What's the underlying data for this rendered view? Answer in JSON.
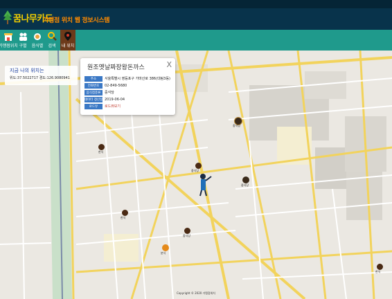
{
  "header": {
    "brand": "꿈나무카드",
    "tagline": "가맹점 위치 웹 정보시스템",
    "colors": {
      "bar": "#08334b",
      "brand": "#f5d000",
      "tagline": "#ff8a00"
    }
  },
  "nav": {
    "items": [
      {
        "label": "가맹점위치",
        "icon": "storefront-icon"
      },
      {
        "label": "구별",
        "icon": "people-icon"
      },
      {
        "label": "음식별",
        "icon": "food-icon"
      },
      {
        "label": "검색",
        "icon": "search-icon"
      },
      {
        "label": "내 위치",
        "icon": "location-pin-icon",
        "active": true
      }
    ],
    "colors": {
      "bar": "#1f9a8c",
      "active": "#6d3a1a"
    }
  },
  "location": {
    "title": "지금 나의 위치는",
    "coords": "위도:37.5022717 경도:126.9080941"
  },
  "popup": {
    "title": "원조옛날짜장왕돈까스",
    "close": "X",
    "rows": [
      {
        "key": "주소",
        "value": "서울특별시 영등포구 가마산로 386(대림3동)"
      },
      {
        "key": "전화번호",
        "value": "02-849-5680"
      },
      {
        "key": "음식점종류",
        "value": "중식당"
      },
      {
        "key": "데이터 갱신일",
        "value": "2019-06-04"
      },
      {
        "key": "로드뷰",
        "value": "로드뷰보기",
        "link": true
      }
    ]
  },
  "map": {
    "markers": [
      {
        "label": "중식당",
        "icon": "restaurant-marker-icon"
      },
      {
        "label": "한식",
        "icon": "restaurant-marker-icon"
      },
      {
        "label": "중식당",
        "icon": "restaurant-marker-icon"
      },
      {
        "label": "중식당",
        "icon": "restaurant-marker-icon"
      },
      {
        "label": "한식",
        "icon": "restaurant-marker-icon"
      },
      {
        "label": "중식당",
        "icon": "restaurant-marker-icon"
      },
      {
        "label": "분식",
        "icon": "restaurant-marker-icon"
      },
      {
        "label": "한식",
        "icon": "restaurant-marker-icon"
      }
    ]
  },
  "footer": "Copyright © 2020 가맹점위치"
}
